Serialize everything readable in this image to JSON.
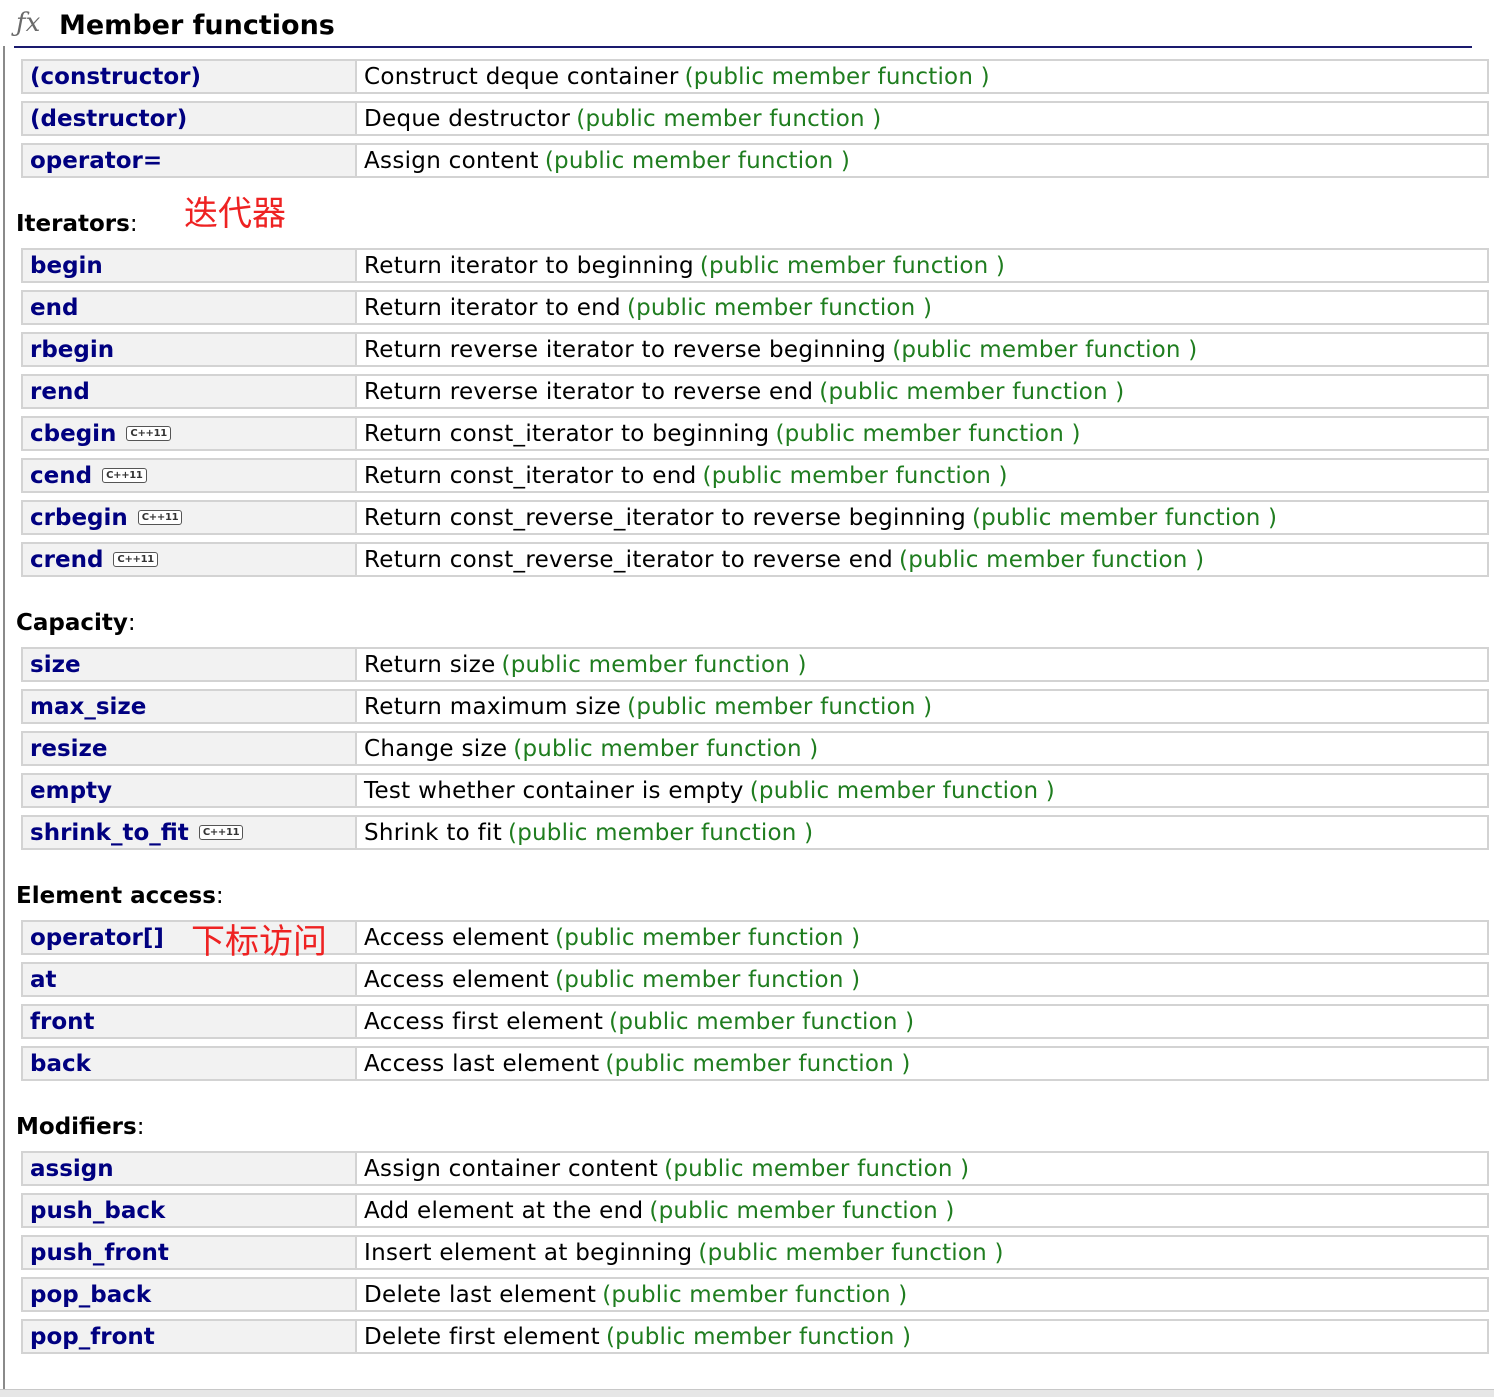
{
  "header": {
    "icon": "fx-icon",
    "fx_glyph": "ƒx",
    "title": "Member functions"
  },
  "tag_text": "(public member function )",
  "badge_text": "C++11",
  "annotations": {
    "iterators_note": "迭代器",
    "operator_index_note": "下标访问"
  },
  "sections": [
    {
      "title": "",
      "rows": [
        {
          "name": "(constructor)",
          "desc": "Construct deque container",
          "tag": "(public member function )"
        },
        {
          "name": "(destructor)",
          "desc": "Deque destructor",
          "tag": "(public member function )"
        },
        {
          "name": "operator=",
          "desc": "Assign content",
          "tag": "(public member function )"
        }
      ]
    },
    {
      "title": "Iterators",
      "rows": [
        {
          "name": "begin",
          "desc": "Return iterator to beginning",
          "tag": "(public member function )"
        },
        {
          "name": "end",
          "desc": "Return iterator to end",
          "tag": "(public member function )"
        },
        {
          "name": "rbegin",
          "desc": "Return reverse iterator to reverse beginning",
          "tag": "(public member function )"
        },
        {
          "name": "rend",
          "desc": "Return reverse iterator to reverse end",
          "tag": "(public member function )"
        },
        {
          "name": "cbegin",
          "badge": "C++11",
          "desc": "Return const_iterator to beginning",
          "tag": "(public member function )"
        },
        {
          "name": "cend",
          "badge": "C++11",
          "desc": "Return const_iterator to end",
          "tag": "(public member function )"
        },
        {
          "name": "crbegin",
          "badge": "C++11",
          "desc": "Return const_reverse_iterator to reverse beginning",
          "tag": "(public member function )"
        },
        {
          "name": "crend",
          "badge": "C++11",
          "desc": "Return const_reverse_iterator to reverse end",
          "tag": "(public member function )"
        }
      ]
    },
    {
      "title": "Capacity",
      "rows": [
        {
          "name": "size",
          "desc": "Return size",
          "tag": "(public member function )"
        },
        {
          "name": "max_size",
          "desc": "Return maximum size",
          "tag": "(public member function )"
        },
        {
          "name": "resize",
          "desc": "Change size",
          "tag": "(public member function )"
        },
        {
          "name": "empty",
          "desc": "Test whether container is empty",
          "tag": "(public member function )"
        },
        {
          "name": "shrink_to_fit",
          "badge": "C++11",
          "desc": "Shrink to fit",
          "tag": "(public member function )"
        }
      ]
    },
    {
      "title": "Element access",
      "rows": [
        {
          "name": "operator[]",
          "desc": "Access element",
          "tag": "(public member function )"
        },
        {
          "name": "at",
          "desc": "Access element",
          "tag": "(public member function )"
        },
        {
          "name": "front",
          "desc": "Access first element",
          "tag": "(public member function )"
        },
        {
          "name": "back",
          "desc": "Access last element",
          "tag": "(public member function )"
        }
      ]
    },
    {
      "title": "Modifiers",
      "rows": [
        {
          "name": "assign",
          "desc": "Assign container content",
          "tag": "(public member function )"
        },
        {
          "name": "push_back",
          "desc": "Add element at the end",
          "tag": "(public member function )"
        },
        {
          "name": "push_front",
          "desc": "Insert element at beginning",
          "tag": "(public member function )"
        },
        {
          "name": "pop_back",
          "desc": "Delete last element",
          "tag": "(public member function )"
        },
        {
          "name": "pop_front",
          "desc": "Delete first element",
          "tag": "(public member function )"
        }
      ]
    }
  ],
  "colors": {
    "name_link": "#000080",
    "tag_green": "#1f7d1f",
    "note_red": "#ee2222",
    "row_border": "#d3d3d3",
    "name_cell_bg": "#f2f2f2"
  }
}
